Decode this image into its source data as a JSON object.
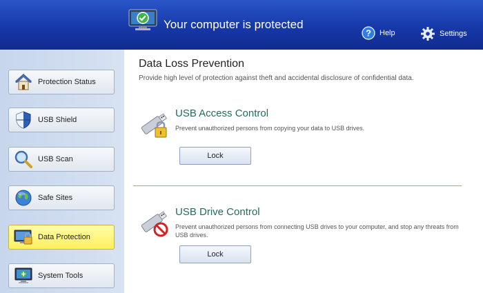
{
  "header": {
    "status_title": "Your computer is protected",
    "help_label": "Help",
    "settings_label": "Settings"
  },
  "sidebar": {
    "items": [
      {
        "label": "Protection Status",
        "icon": "house-icon"
      },
      {
        "label": "USB Shield",
        "icon": "shield-icon"
      },
      {
        "label": "USB Scan",
        "icon": "magnifier-icon"
      },
      {
        "label": "Safe Sites",
        "icon": "globe-icon"
      },
      {
        "label": "Data Protection",
        "icon": "data-protection-icon",
        "active": true
      },
      {
        "label": "System Tools",
        "icon": "monitor-icon"
      }
    ]
  },
  "main": {
    "title": "Data Loss Prevention",
    "description": "Provide high level of protection against theft and accidental disclosure of confidential data.",
    "sections": [
      {
        "title": "USB Access Control",
        "description": "Prevent unauthorized persons from copying your data to USB drives.",
        "button_label": "Lock"
      },
      {
        "title": "USB Drive Control",
        "description": "Prevent unauthorized persons from connecting USB drives to your computer, and stop any threats from USB drives.",
        "button_label": "Lock"
      }
    ]
  },
  "colors": {
    "header_blue": "#1638a8",
    "active_nav": "#fff05c",
    "section_title": "#236b5b"
  }
}
